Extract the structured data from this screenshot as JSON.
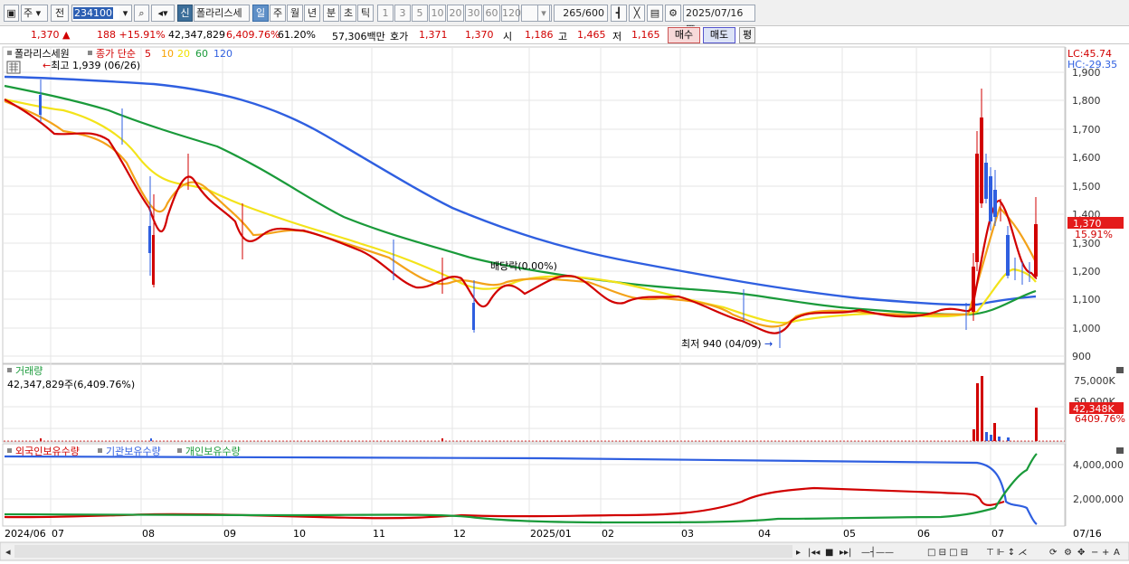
{
  "toolbar": {
    "market": "주",
    "prev_label": "전",
    "code": "234100",
    "name": "폴라리스세",
    "new_badge": "신",
    "periods": [
      "일",
      "주",
      "월",
      "년",
      "분",
      "초",
      "틱"
    ],
    "selected_period": "일",
    "minutes": [
      "1",
      "3",
      "5",
      "10",
      "20",
      "30",
      "60",
      "120"
    ],
    "count": "265",
    "count_max": "/600",
    "date": "2025/07/16"
  },
  "quote": {
    "price": "1,370 ▲",
    "change": "188 +15.91%",
    "volume": "42,347,829",
    "vol_ratio": "6,409.76%",
    "turnover_ratio": "61.20%",
    "amount": "57,306백만",
    "hoga_label": "호가",
    "ask": "1,371",
    "bid": "1,370",
    "open_label": "시",
    "open": "1,186",
    "high_label": "고",
    "high": "1,465",
    "low_label": "저",
    "low": "1,165",
    "buy": "매수",
    "sell": "매도",
    "eval": "평"
  },
  "price_panel": {
    "name": "폴라리스세원",
    "legend_prefix": "종가 단순",
    "ma_labels": [
      "5",
      "10",
      "20",
      "60",
      "120"
    ],
    "ma_colors": [
      "#d10000",
      "#f7a000",
      "#f0e000",
      "#1a9a3a",
      "#2f5fe0"
    ],
    "high_note": "최고 1,939 (06/26)",
    "low_note": "최저 940 (04/09)",
    "div_note": "배당락(0.00%)",
    "lc": "LC:45.74",
    "hc": "HC:-29.35",
    "y_ticks": [
      "1,900",
      "1,800",
      "1,700",
      "1,600",
      "1,500",
      "1,400",
      "1,300",
      "1,200",
      "1,100",
      "1,000",
      "900"
    ],
    "last_price": "1,370",
    "last_change": "15.91%"
  },
  "volume_panel": {
    "title": "거래량",
    "value": "42,347,829주(6,409.76%)",
    "y_ticks": [
      "75,000K",
      "50,000K"
    ],
    "last_vol": "42,348K",
    "last_ratio": "6409.76%"
  },
  "holding_panel": {
    "labels": [
      "외국인보유수량",
      "기관보유수량",
      "개인보유수량"
    ],
    "colors": [
      "#d10000",
      "#2f5fe0",
      "#1a9a3a"
    ],
    "y_ticks": [
      "4,000,000",
      "2,000,000"
    ]
  },
  "x_axis": [
    "2024/06",
    "07",
    "08",
    "09",
    "10",
    "11",
    "12",
    "2025/01",
    "02",
    "03",
    "04",
    "05",
    "06",
    "07"
  ],
  "x_right_label": "07/16"
}
